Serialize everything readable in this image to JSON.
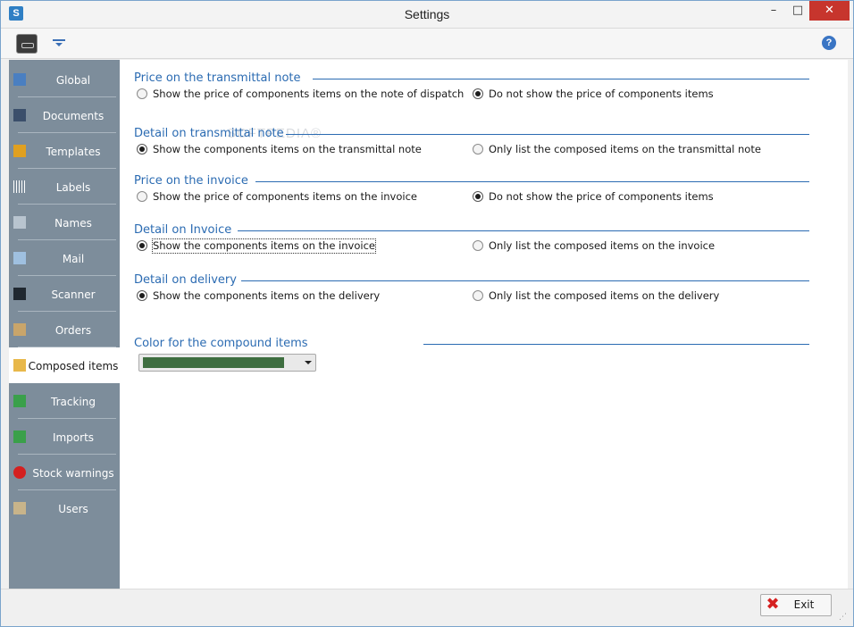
{
  "window": {
    "title": "Settings",
    "app_icon_letter": "S",
    "minimize_glyph": "–",
    "maximize_glyph": "□",
    "close_glyph": "✕"
  },
  "toolbar": {
    "help_glyph": "?"
  },
  "watermark": "SOFTPEDIA®",
  "sidebar": {
    "items": [
      {
        "label": "Global",
        "icon": "global-settings-icon",
        "color": "#4a7fc1"
      },
      {
        "label": "Documents",
        "icon": "documents-icon",
        "color": "#3b4f6b"
      },
      {
        "label": "Templates",
        "icon": "templates-icon",
        "color": "#e0a020"
      },
      {
        "label": "Labels",
        "icon": "barcode-icon",
        "color": "#ffffff"
      },
      {
        "label": "Names",
        "icon": "names-icon",
        "color": "#b8c4cf"
      },
      {
        "label": "Mail",
        "icon": "mail-icon",
        "color": "#9fc0e0"
      },
      {
        "label": "Scanner",
        "icon": "scanner-icon",
        "color": "#202830"
      },
      {
        "label": "Orders",
        "icon": "orders-icon",
        "color": "#c9a56a"
      },
      {
        "label": "Composed items",
        "icon": "composed-items-icon",
        "color": "#e8b84a"
      },
      {
        "label": "Tracking",
        "icon": "tracking-icon",
        "color": "#3aa04a"
      },
      {
        "label": "Imports",
        "icon": "imports-icon",
        "color": "#3aa04a"
      },
      {
        "label": "Stock warnings",
        "icon": "warning-icon",
        "color": "#d42020"
      },
      {
        "label": "Users",
        "icon": "users-icon",
        "color": "#c8b48a"
      }
    ],
    "active_label": "Composed items"
  },
  "sections": [
    {
      "title": "Price on the  transmittal note",
      "options": [
        {
          "label": "Show the price of components items on the note of dispatch",
          "checked": false
        },
        {
          "label": "Do not show the price of components items",
          "checked": true
        }
      ]
    },
    {
      "title": "Detail on transmittal note",
      "options": [
        {
          "label": "Show the components items on the transmittal note",
          "checked": true
        },
        {
          "label": "Only list the composed items on the transmittal note",
          "checked": false
        }
      ]
    },
    {
      "title": "Price on the invoice",
      "options": [
        {
          "label": "Show the price of components items on the invoice",
          "checked": false
        },
        {
          "label": "Do not show the price of components items",
          "checked": true
        }
      ]
    },
    {
      "title": "Detail on Invoice",
      "options": [
        {
          "label": "Show the components items on the invoice",
          "checked": true
        },
        {
          "label": "Only list the composed items on the invoice",
          "checked": false
        }
      ]
    },
    {
      "title": "Detail on delivery",
      "options": [
        {
          "label": "Show the components items on the delivery",
          "checked": true
        },
        {
          "label": "Only list the composed items on the delivery",
          "checked": false
        }
      ]
    }
  ],
  "color_section": {
    "title": "Color for the compound items",
    "selected_color": "#3e6e40"
  },
  "footer": {
    "exit_label": "Exit",
    "exit_glyph": "✖"
  }
}
